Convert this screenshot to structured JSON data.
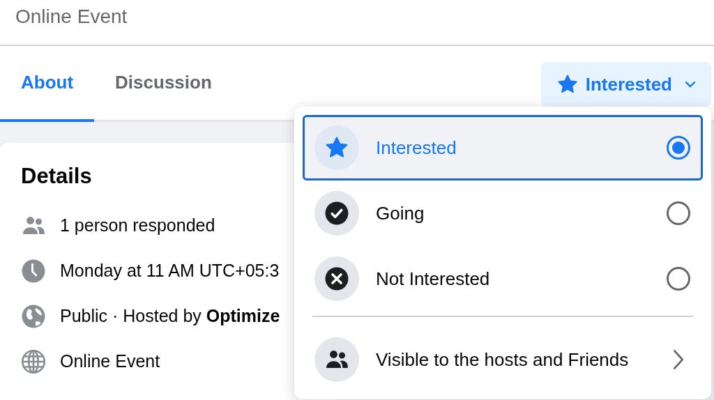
{
  "header": {
    "title": "Online Event"
  },
  "tabs": [
    {
      "label": "About",
      "selected": true
    },
    {
      "label": "Discussion",
      "selected": false
    }
  ],
  "response_button": {
    "label": "Interested"
  },
  "details": {
    "title": "Details",
    "items": [
      {
        "text": "1 person responded"
      },
      {
        "text": "Monday at 11 AM UTC+05:3"
      },
      {
        "text": "Public · Hosted by **Optimize**"
      },
      {
        "text": "Online Event"
      }
    ]
  },
  "menu": {
    "options": [
      {
        "kind": "radio",
        "label": "Interested",
        "selected": true
      },
      {
        "kind": "radio",
        "label": "Going",
        "selected": false
      },
      {
        "kind": "radio",
        "label": "Not Interested",
        "selected": false
      },
      {
        "kind": "submenu",
        "label": "Visible to the hosts and Friends"
      }
    ]
  }
}
